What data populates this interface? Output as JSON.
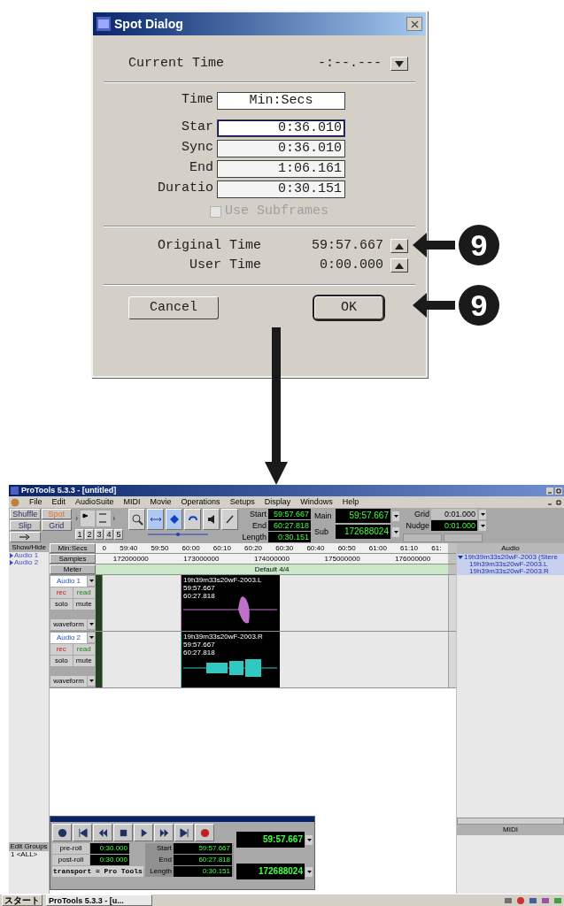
{
  "spot_dialog": {
    "title": "Spot Dialog",
    "current_time": {
      "label": "Current Time",
      "value": "-:--.---"
    },
    "time_format": {
      "label": "Time",
      "value": "Min:Secs"
    },
    "fields": [
      {
        "label": "Star",
        "value": "0:36.010",
        "selected": true
      },
      {
        "label": "Sync",
        "value": "0:36.010",
        "selected": false
      },
      {
        "label": "End",
        "value": "1:06.161",
        "selected": false
      },
      {
        "label": "Duratio",
        "value": "0:30.151",
        "selected": false
      }
    ],
    "use_subframes": {
      "label": "Use Subframes",
      "checked": false,
      "disabled": true
    },
    "times": [
      {
        "label": "Original Time",
        "value": "59:57.667"
      },
      {
        "label": "User Time",
        "value": "0:00.000"
      }
    ],
    "buttons": [
      {
        "label": "Cancel",
        "default": false
      },
      {
        "label": "OK",
        "default": true
      }
    ]
  },
  "callouts": [
    "9",
    "9"
  ],
  "pro_tools": {
    "title": "ProTools 5.3.3 - [untitled]",
    "menu": [
      "File",
      "Edit",
      "AudioSuite",
      "MIDI",
      "Movie",
      "Operations",
      "Setups",
      "Display",
      "Windows",
      "Help"
    ],
    "edit_modes": [
      {
        "label": "Shuffle",
        "selected": false
      },
      {
        "label": "Spot",
        "selected": true
      },
      {
        "label": "Slip",
        "selected": false
      },
      {
        "label": "Grid",
        "selected": false
      }
    ],
    "zoom_presets": [
      "1",
      "2",
      "3",
      "4",
      "5"
    ],
    "selection": [
      {
        "label": "Start",
        "value": "59:57.667"
      },
      {
        "label": "End",
        "value": "60:27.818"
      },
      {
        "label": "Length",
        "value": "0:30.151"
      }
    ],
    "main_counter": {
      "label": "Main",
      "value": "59:57.667"
    },
    "sub_counter": {
      "label": "Sub",
      "value": "172688024"
    },
    "grid": {
      "label": "Grid",
      "value": "0:01.000"
    },
    "nudge": {
      "label": "Nudge",
      "value": "0:01.000"
    },
    "show_hide": "Show/Hide",
    "track_list": [
      "Audio 1",
      "Audio 2"
    ],
    "rulers": [
      {
        "label": "Min:Secs",
        "ticks": [
          "0",
          "59:40",
          "59:50",
          "60:00",
          "60:10",
          "60:20",
          "60:30",
          "60:40",
          "60:50",
          "61:00",
          "61:10",
          "61:"
        ]
      },
      {
        "label": "Samples",
        "ticks": [
          "172000000",
          "173000000",
          "174000000",
          "175000000",
          "176000000"
        ]
      },
      {
        "label": "Meter",
        "ticks": [
          "Default 4/4"
        ]
      }
    ],
    "tracks": [
      {
        "name": "Audio 1",
        "buttons": [
          "rec",
          "read",
          "solo",
          "mute"
        ],
        "view": "waveform",
        "region": {
          "name": "19h39m33s20wF-2003.L",
          "start": "59:57.667",
          "end": "60:27.818",
          "color": "#c070c8"
        }
      },
      {
        "name": "Audio 2",
        "buttons": [
          "rec",
          "read",
          "solo",
          "mute"
        ],
        "view": "waveform",
        "region": {
          "name": "19h39m33s20wF-2003.R",
          "start": "59:57.667",
          "end": "60:27.818",
          "color": "#30c8c0"
        }
      }
    ],
    "audio_regions": {
      "header": "Audio",
      "items": [
        "19h39m33s20wF-2003 (Stere",
        "19h39m33s20wF-2003.L",
        "19h39m33s20wF-2003.R"
      ]
    },
    "midi_regions": {
      "header": "MIDI"
    },
    "edit_groups": {
      "header": "Edit Groups",
      "items": [
        "1 <ALL>"
      ]
    },
    "transport": {
      "preroll": {
        "label": "pre-roll",
        "value": "0:30.000"
      },
      "postroll": {
        "label": "post-roll",
        "value": "0:30.000"
      },
      "mode": "transport = Pro Tools",
      "times": [
        {
          "label": "Start",
          "value": "59:57.667"
        },
        {
          "label": "End",
          "value": "60:27.818"
        },
        {
          "label": "Length",
          "value": "0:30.151"
        }
      ],
      "main": "59:57.667",
      "sub": "172688024"
    },
    "taskbar": {
      "start": "スタート",
      "tasks": [
        "ProTools 5.3.3 - [u..."
      ]
    }
  }
}
